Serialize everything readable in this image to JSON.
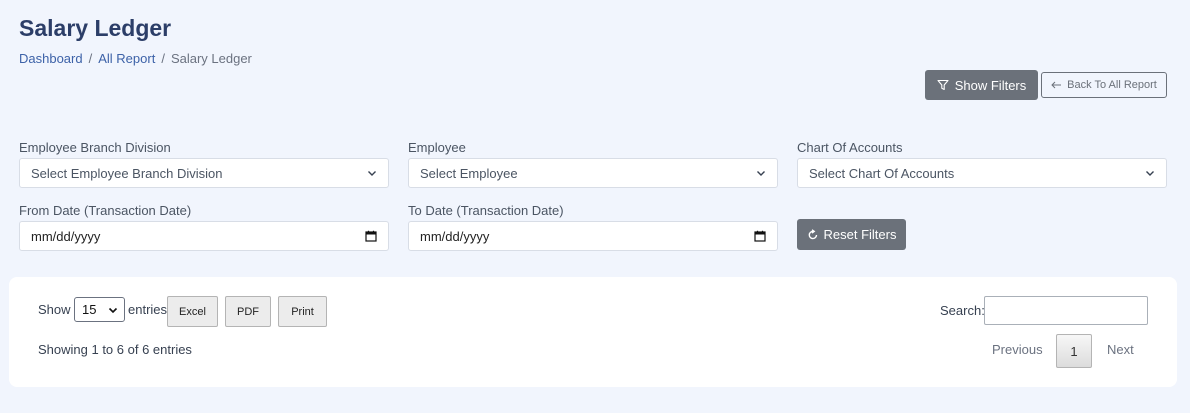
{
  "page": {
    "title": "Salary Ledger",
    "breadcrumb": [
      "Dashboard",
      "All Report",
      "Salary Ledger"
    ],
    "breadcrumb_separator": "/"
  },
  "actions": {
    "show_filters": "Show Filters",
    "back": "Back To All Report",
    "reset_filters": "Reset Filters"
  },
  "filters": {
    "branch": {
      "label": "Employee Branch Division",
      "placeholder": "Select Employee Branch Division"
    },
    "employee": {
      "label": "Employee",
      "placeholder": "Select Employee"
    },
    "accounts": {
      "label": "Chart Of Accounts",
      "placeholder": "Select Chart Of Accounts"
    },
    "from_date": {
      "label": "From Date (Transaction Date)",
      "placeholder": "mm/dd/yyyy"
    },
    "to_date": {
      "label": "To Date (Transaction Date)",
      "placeholder": "mm/dd/yyyy"
    }
  },
  "table": {
    "show_label": "Show",
    "entries_value": "15",
    "entries_label": "entries",
    "export_buttons": [
      "Excel",
      "PDF",
      "Print"
    ],
    "search_label": "Search:",
    "search_value": "",
    "info": "Showing 1 to 6 of 6 entries",
    "pagination": {
      "previous": "Previous",
      "current": "1",
      "next": "Next"
    }
  },
  "colors": {
    "background": "#f1f5fd",
    "title": "#2c3e68",
    "link": "#3d62a8",
    "button_gray": "#6b717a"
  },
  "icons": {
    "show_filters": "filter-icon",
    "back": "arrow-left-icon",
    "reset": "refresh-icon",
    "select": "chevron-down-icon",
    "date": "calendar-icon"
  }
}
